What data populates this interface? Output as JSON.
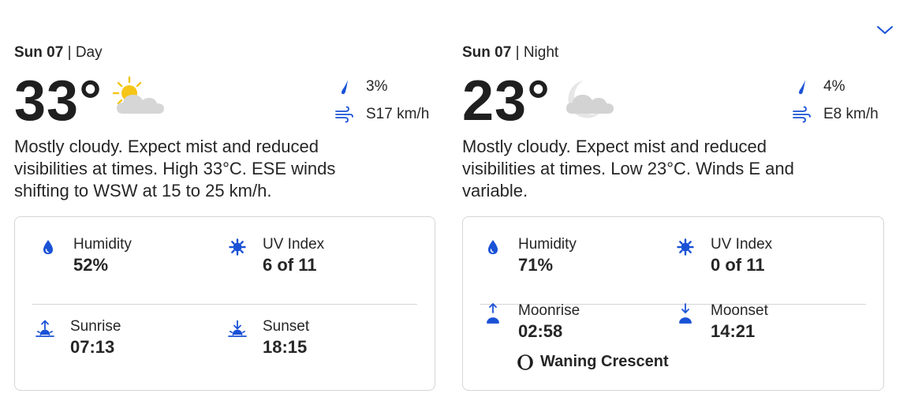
{
  "colors": {
    "accent": "#1a52d6",
    "text": "#262626",
    "border": "#d6d6d6"
  },
  "day": {
    "date": "Sun 07",
    "separator": "|",
    "period": "Day",
    "temperature": "33°",
    "condition_icon": "sun-behind-cloud-icon",
    "precip": "3%",
    "wind": "S17 km/h",
    "description": "Mostly cloudy. Expect mist and reduced visibilities at times. High 33°C. ESE winds shifting to WSW at 15 to 25 km/h.",
    "details": {
      "humidity_label": "Humidity",
      "humidity_value": "52%",
      "uv_label": "UV Index",
      "uv_value": "6 of 11",
      "rise_label": "Sunrise",
      "rise_value": "07:13",
      "set_label": "Sunset",
      "set_value": "18:15"
    }
  },
  "night": {
    "date": "Sun 07",
    "separator": "|",
    "period": "Night",
    "temperature": "23°",
    "condition_icon": "moon-behind-cloud-icon",
    "precip": "4%",
    "wind": "E8 km/h",
    "description": "Mostly cloudy. Expect mist and reduced visibilities at times. Low 23°C. Winds E and variable.",
    "details": {
      "humidity_label": "Humidity",
      "humidity_value": "71%",
      "uv_label": "UV Index",
      "uv_value": "0 of 11",
      "rise_label": "Moonrise",
      "rise_value": "02:58",
      "set_label": "Moonset",
      "set_value": "14:21",
      "moon_phase": "Waning Crescent"
    }
  }
}
